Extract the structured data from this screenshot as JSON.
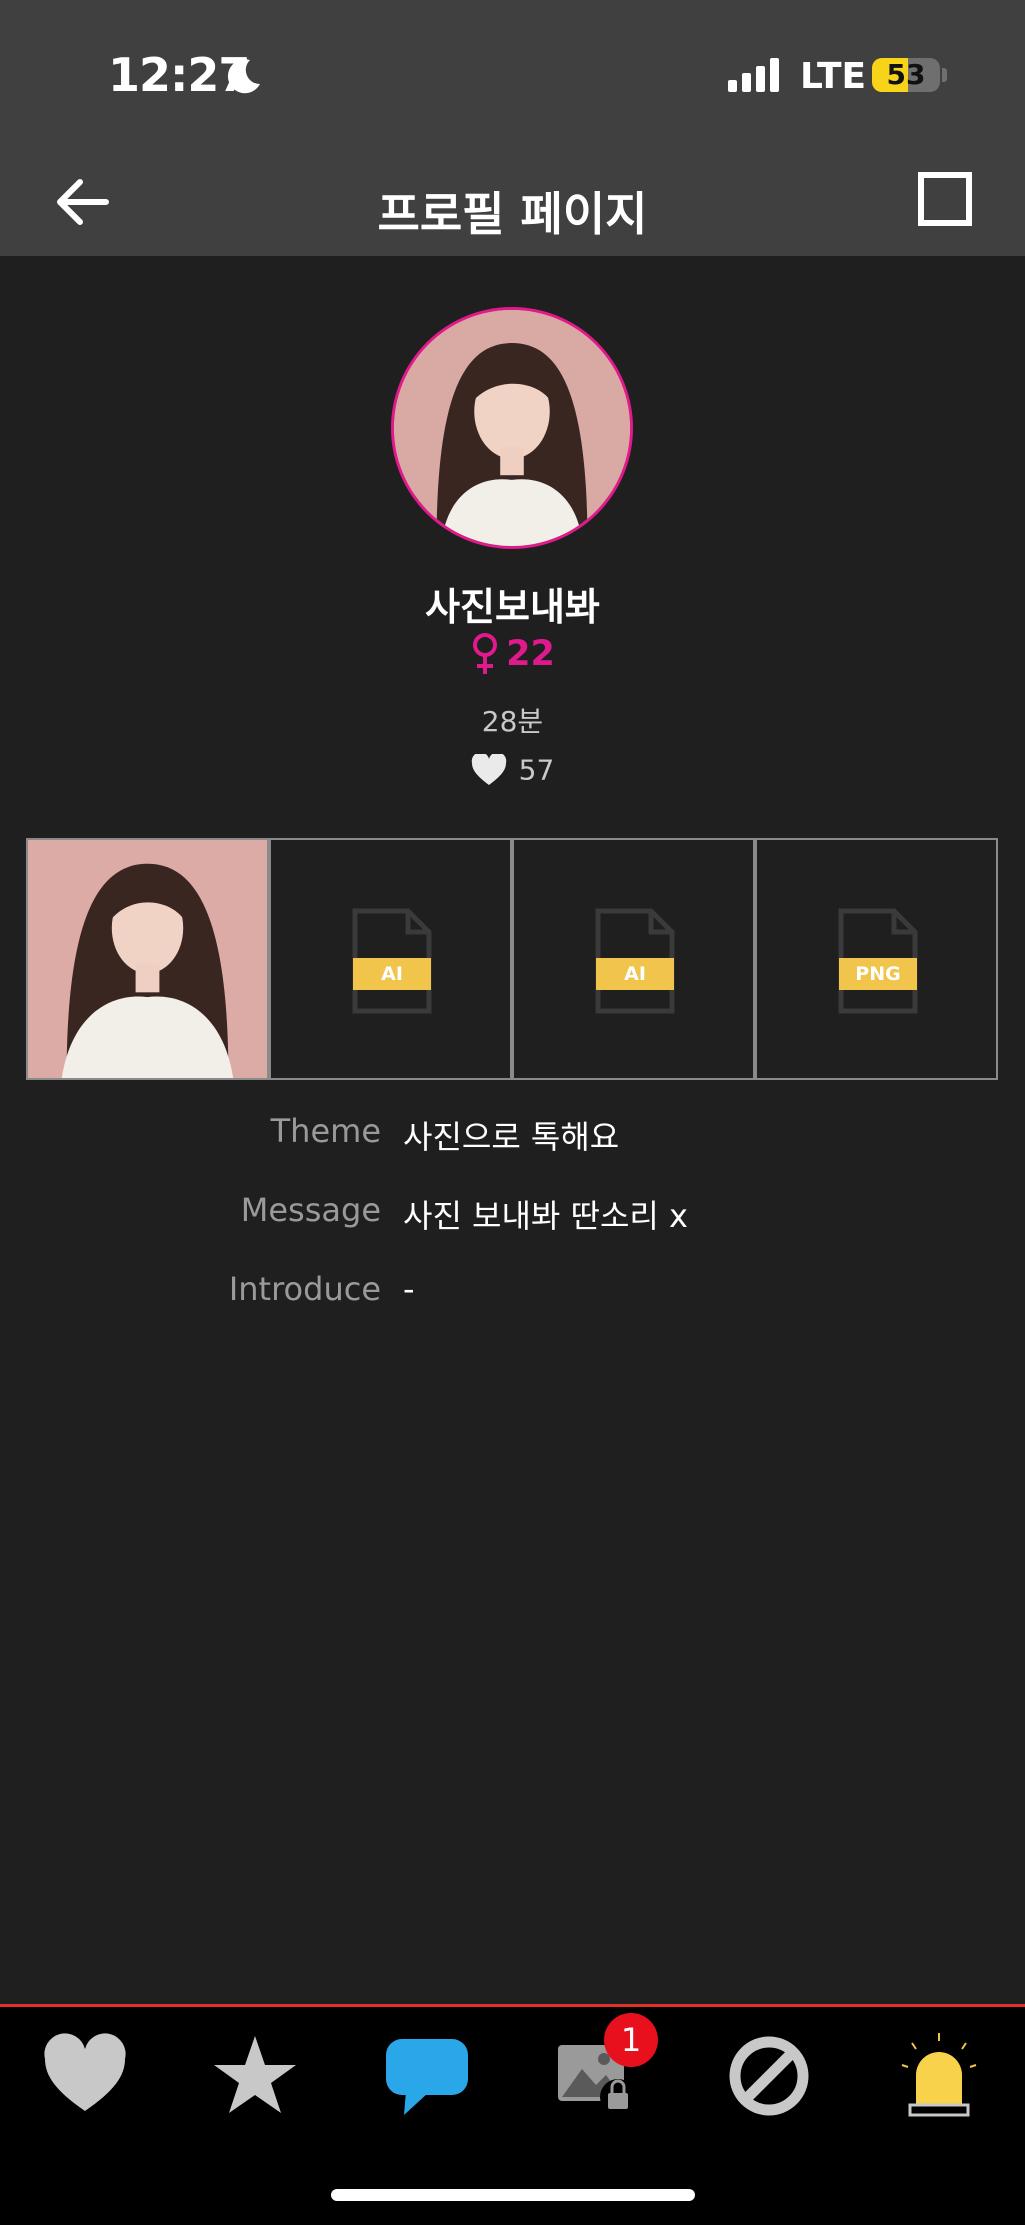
{
  "status_bar": {
    "time": "12:27",
    "network": "LTE",
    "battery_percent": "53",
    "battery_level": 0.53
  },
  "header": {
    "title": "프로필 페이지"
  },
  "profile": {
    "name": "사진보내봐",
    "gender_symbol": "♀",
    "age": "22",
    "last_seen": "28분",
    "likes": "57",
    "accent_color": "#e0198c"
  },
  "gallery": {
    "files": [
      {
        "badge": "AI"
      },
      {
        "badge": "AI"
      },
      {
        "badge": "PNG"
      }
    ]
  },
  "info": [
    {
      "label": "Theme",
      "value": "사진으로 톡해요"
    },
    {
      "label": "Message",
      "value": "사진 보내봐 딴소리 x"
    },
    {
      "label": "Introduce",
      "value": "-"
    }
  ],
  "tabs": {
    "photo_badge": "1",
    "icons": [
      "heart-icon",
      "star-icon",
      "chat-bubble-icon",
      "locked-photo-icon",
      "block-icon",
      "siren-icon"
    ]
  }
}
